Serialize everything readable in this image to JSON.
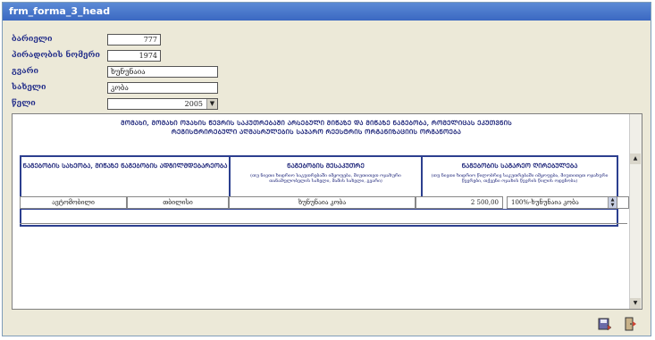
{
  "window": {
    "title": "frm_forma_3_head"
  },
  "form": {
    "fields": [
      {
        "label": "ბარიელი",
        "value": "777"
      },
      {
        "label": "პირადობის ნომერი",
        "value": "1974"
      },
      {
        "label": "გვარი",
        "value": "ხუნუნაია"
      },
      {
        "label": "სახელი",
        "value": "კობა"
      },
      {
        "label": "წელი",
        "value": "2005"
      }
    ]
  },
  "panel": {
    "heading_line1": "ᲛᲝᲛᲐᲮᲘ, ᲛᲝᲛᲐᲮᲘ ᲝᲯᲐᲮᲘᲡ ᲬᲔᲕᲠᲘᲡ ᲡᲐᲙᲣᲗᲠᲔᲑᲐᲨᲘ ᲐᲠᲡᲔᲑᲣᲚᲘ ᲛᲘᲬᲐᲖᲔ ᲓᲐ ᲛᲘᲬᲐᲖᲔ ᲜᲐᲒᲔᲑᲝᲑᲐ, ᲠᲝᲛᲔᲚᲘᲪᲐᲡ ᲔᲙᲣᲗᲕᲜᲘᲡ",
    "heading_line2": "ᲠᲔᲒᲘᲡᲢᲠᲘᲠᲔᲑᲣᲚᲘ ᲐᲦᲛᲐᲡᲠᲣᲚᲔᲑᲘᲡ ᲡᲐᲯᲐᲠᲝ ᲠᲔᲔᲡᲢᲠᲘᲡ ᲝᲠᲒᲐᲜᲘᲖᲐᲪᲘᲘᲡ ᲝᲠᲒᲐᲜᲝᲔᲑᲐ",
    "columns": [
      {
        "title": "ᲜᲐᲒᲔᲑᲝᲑᲘᲡ ᲡᲐᲮᲔᲝᲑᲐ, ᲛᲘᲬᲐᲖᲔ ᲜᲐᲒᲔᲑᲝᲑᲘᲡ ᲐᲓᲒᲘᲚᲛᲓᲔᲑᲐᲠᲔᲝᲑᲐ",
        "subtitle": ""
      },
      {
        "title": "ᲜᲐᲒᲔᲑᲝᲑᲘᲡ ᲛᲔᲡᲐᲙᲣᲗᲠᲔ",
        "subtitle": "(თუ ნივთი ხიდრიო საკუთრებაში იმყოფება, მიუთითეთ ოჯახური თანამფლობელის სახელი, მამის სახელი, გვარი)"
      },
      {
        "title": "ᲜᲐᲒᲔᲑᲝᲑᲘᲡ ᲡᲐᲒᲐᲠᲔᲝ ᲦᲘᲠᲔᲑᲣᲚᲔᲑᲐ",
        "subtitle": "(თუ ნივთი ხიდრიო წილობრივ საკუთრებაში იმყოფება, მიუთითეთ ოჯახური წევრები, თქვენი ოჯახის წევრის წილის ოდენობა)"
      }
    ],
    "row": [
      "ავტომობილი",
      "თბილისი",
      "ხუნუნაია კობა",
      "2 500,00",
      "100%-ხუნუნაია კობა"
    ]
  },
  "toolbar": {
    "icons": [
      "save-icon",
      "exit-icon"
    ]
  }
}
